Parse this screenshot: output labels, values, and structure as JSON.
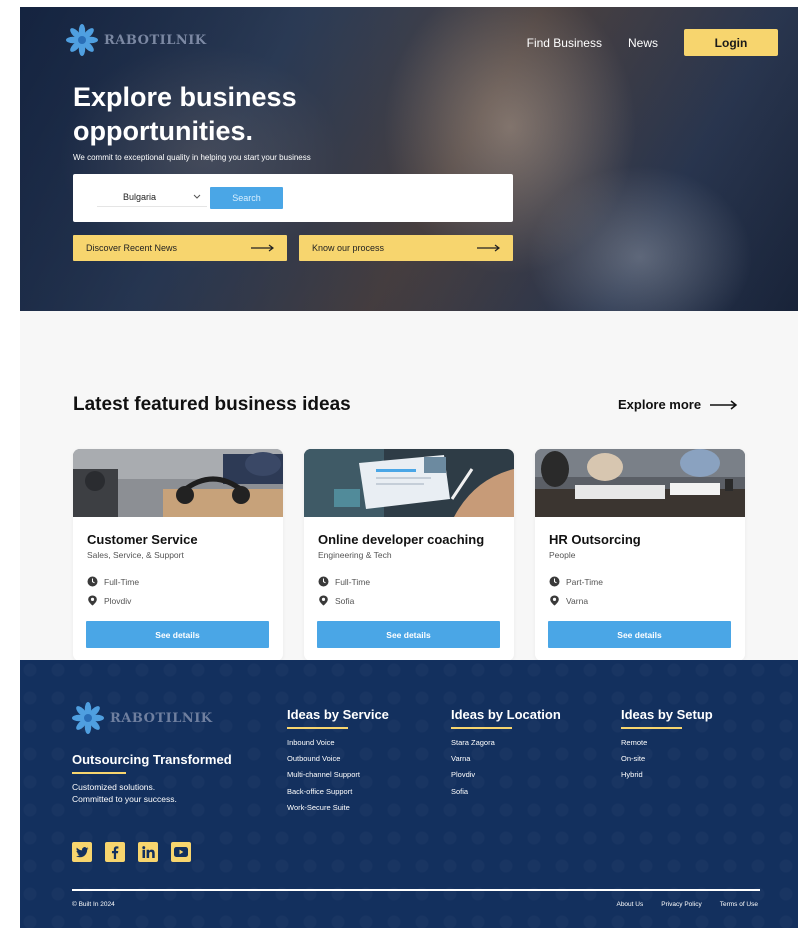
{
  "brand": {
    "name": "RABOTILNIK"
  },
  "nav": {
    "find_business": "Find Business",
    "news": "News",
    "login": "Login"
  },
  "hero": {
    "title": "Explore business opportunities.",
    "subtitle": "We commit to exceptional quality in helping you start your business",
    "country": "Bulgaria",
    "search_label": "Search",
    "cta_news": "Discover Recent News",
    "cta_process": "Know our process"
  },
  "featured": {
    "title": "Latest featured business ideas",
    "explore": "Explore more",
    "details_label": "See details",
    "cards": [
      {
        "title": "Customer Service",
        "category": "Sales, Service, & Support",
        "type": "Full-Time",
        "location": "Plovdiv"
      },
      {
        "title": "Online developer coaching",
        "category": "Engineering & Tech",
        "type": "Full-Time",
        "location": "Sofia"
      },
      {
        "title": "HR Outsorcing",
        "category": "People",
        "type": "Part-Time",
        "location": "Varna"
      }
    ]
  },
  "footer": {
    "tagline": "Outsourcing Transformed",
    "desc1": "Customized solutions.",
    "desc2": "Committed to your success.",
    "columns": [
      {
        "title": "Ideas by Service",
        "items": [
          "Inbound Voice",
          "Outbound Voice",
          "Multi-channel Support",
          "Back-office Support",
          "Work-Secure Suite"
        ]
      },
      {
        "title": "Ideas by Location",
        "items": [
          "Stara Zagora",
          "Varna",
          "Plovdiv",
          "Sofia"
        ]
      },
      {
        "title": "Ideas by Setup",
        "items": [
          "Remote",
          "On-site",
          "Hybrid"
        ]
      }
    ],
    "copyright": "© Built In 2024",
    "links": [
      "About Us",
      "Privacy Policy",
      "Terms of Use"
    ]
  },
  "colors": {
    "accent": "#f7d56e",
    "primary": "#4aa6e6",
    "footer_bg": "#13305e"
  },
  "icons": [
    "logo-flower-icon",
    "chevron-down-icon",
    "arrow-right-icon",
    "clock-icon",
    "location-pin-icon",
    "twitter-icon",
    "facebook-icon",
    "linkedin-icon",
    "youtube-icon"
  ]
}
